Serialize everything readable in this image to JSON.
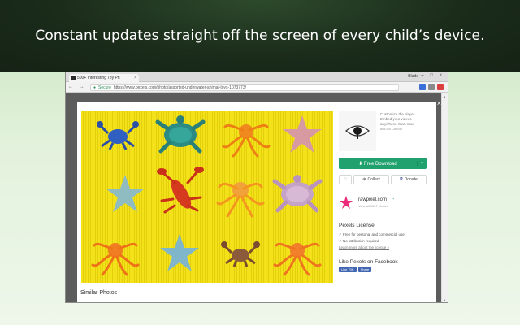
{
  "banner": {
    "text": "Constant updates straight off the screen of every child’s device."
  },
  "browser": {
    "tab": {
      "title": "500+ Interesting Toy Ph",
      "close": "×"
    },
    "user_label": "Blade",
    "window_controls": "– □ ×",
    "nav_icons": "← → ⟳",
    "address": {
      "secure_label": "Secure",
      "url": "https://www.pexels.com/photo/assorted-underwater-animal-toys-1073773/"
    },
    "extension_colors": [
      "#3b6fd8",
      "#8a8a8a",
      "#d94141"
    ]
  },
  "modal": {
    "close": "×",
    "similar_label": "Similar Photos",
    "ad": {
      "text": "Customize the player. Embed your videos anywhere. Start now.",
      "by": "ads via Carbon"
    },
    "download": {
      "label": "Free Download",
      "caret": "▾"
    },
    "actions": {
      "like": "♡",
      "collect": "Collect",
      "donate": "Donate"
    },
    "author": {
      "name": "rawpixel.com",
      "sub": "View all 1027 photos",
      "follow": "+"
    },
    "license": {
      "title": "Pexels License",
      "items": [
        "✓ Free for personal and commercial use",
        "✓ No attribution required"
      ],
      "link": "Learn more about the license »"
    },
    "facebook": {
      "title": "Like Pexels on Facebook",
      "like_label": "Like 70K",
      "share_label": "Share"
    }
  },
  "colors": {
    "download_green": "#20a16e",
    "photo_yellow": "#f3e21a",
    "avatar_pink": "#ee2a7b",
    "facebook_blue": "#4267b2"
  }
}
